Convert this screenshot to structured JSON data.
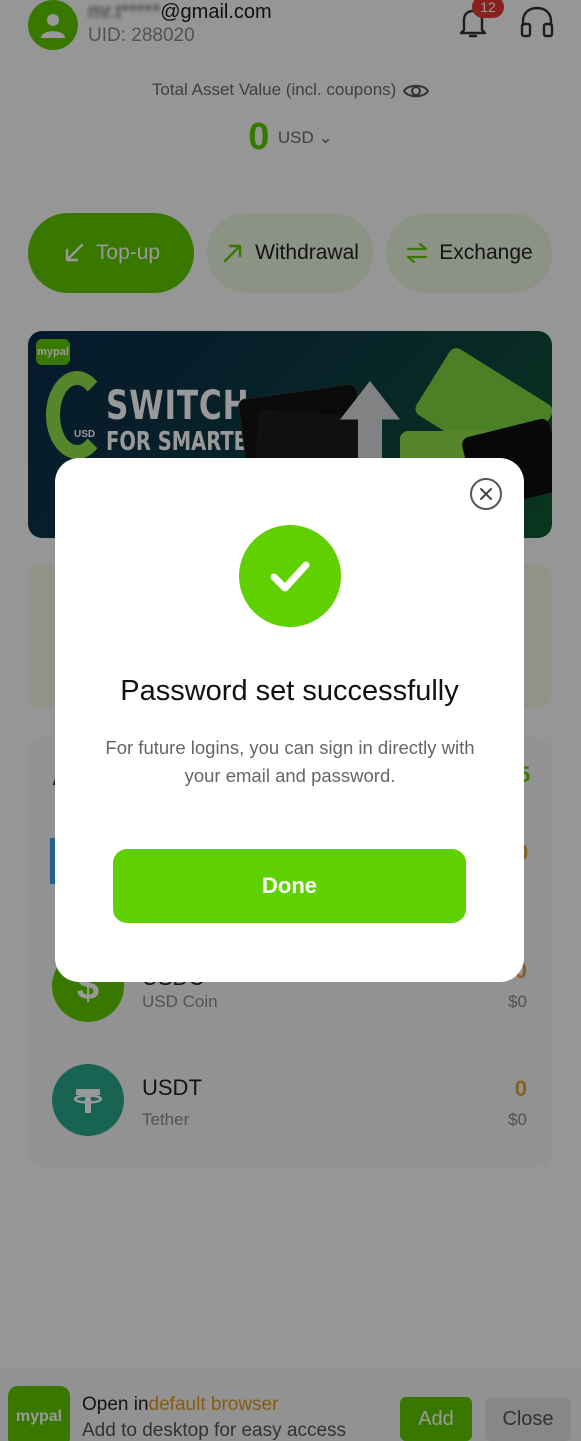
{
  "header": {
    "email_masked": "mr.t*****",
    "email_domain": "@gmail.com",
    "uid": "UID: 288020",
    "notification_count": "12"
  },
  "balance": {
    "label": "Total Asset Value (incl. coupons)",
    "value": "0",
    "currency": "USD"
  },
  "actions": {
    "topup": "Top-up",
    "withdrawal": "Withdrawal",
    "exchange": "Exchange"
  },
  "banner": {
    "brand": "mypal",
    "title_line1": "SWITCH",
    "title_line2": "FOR SMARTER",
    "usd_tag": "USD"
  },
  "assets": [
    {
      "name": "USDC",
      "subtitle": "USD Coin",
      "amount": "0",
      "usd": "$0"
    },
    {
      "name": "USDT",
      "subtitle": "Tether",
      "amount": "0",
      "usd": "$0"
    }
  ],
  "modal": {
    "title": "Password set successfully",
    "message": "For future logins, you can sign in directly with your email and password.",
    "done_label": "Done"
  },
  "install_bar": {
    "logo_text": "mypal",
    "line1_prefix": "Open in",
    "line1_highlight": "default browser",
    "line2": "Add to desktop for easy access",
    "add_label": "Add",
    "close_label": "Close"
  },
  "colors": {
    "brand_green": "#5fc800",
    "accent_orange": "#e0a23b",
    "badge_red": "#e53935"
  }
}
